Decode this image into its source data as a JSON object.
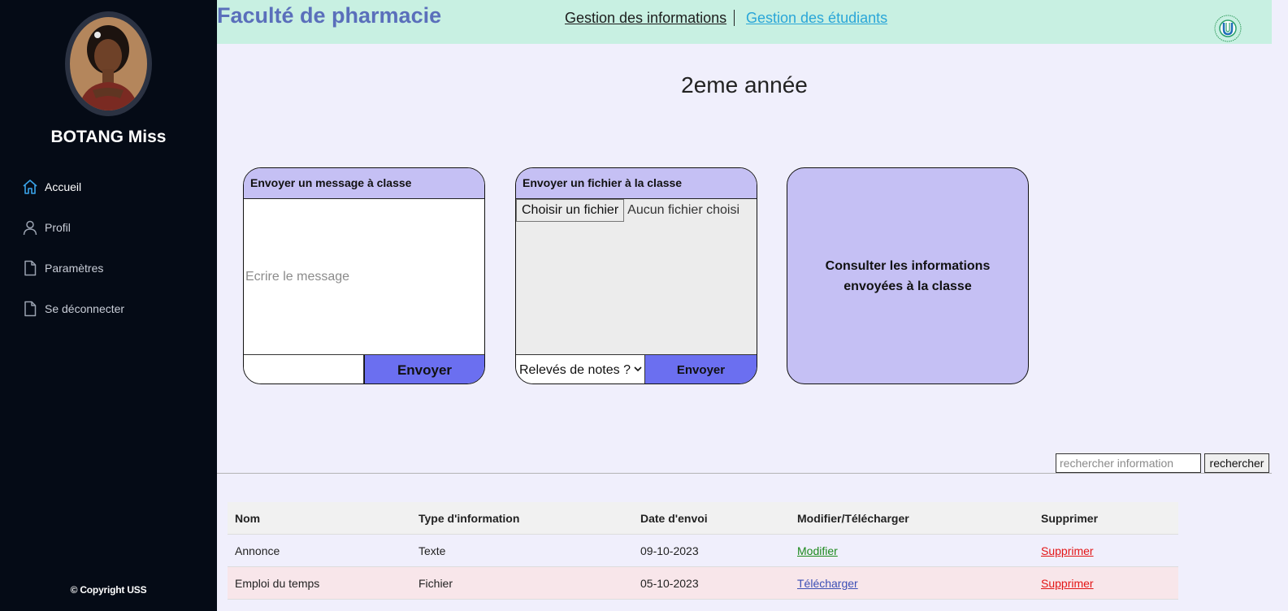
{
  "sidebar": {
    "username": "BOTANG Miss",
    "items": [
      {
        "label": "Accueil",
        "icon": "home-icon",
        "active": true
      },
      {
        "label": "Profil",
        "icon": "user-icon",
        "active": false
      },
      {
        "label": "Paramètres",
        "icon": "file-icon",
        "active": false
      },
      {
        "label": "Se déconnecter",
        "icon": "file-icon",
        "active": false
      }
    ],
    "copyright": "© Copyright USS"
  },
  "header": {
    "title": "Faculté de pharmacie",
    "link_info": "Gestion des informations",
    "link_etudiants": "Gestion des étudiants"
  },
  "page_title": "2eme année",
  "card_message": {
    "title": "Envoyer un message à classe",
    "placeholder": "Ecrire le message",
    "button": "Envoyer"
  },
  "card_file": {
    "title": "Envoyer un fichier à la classe",
    "choose_button": "Choisir un fichier",
    "no_file": "Aucun fichier choisi",
    "select_value": "Relevés de notes ?",
    "button": "Envoyer"
  },
  "card_consult": {
    "label": "Consulter les informations envoyées à la classe"
  },
  "search": {
    "placeholder": "rechercher information",
    "button": "rechercher"
  },
  "table": {
    "columns": [
      "Nom",
      "Type d'information",
      "Date d'envoi",
      "Modifier/Télécharger",
      "Supprimer"
    ],
    "rows": [
      {
        "nom": "Annonce",
        "type": "Texte",
        "date": "09-10-2023",
        "action": "Modifier",
        "delete": "Supprimer"
      },
      {
        "nom": "Emploi du temps",
        "type": "Fichier",
        "date": "05-10-2023",
        "action": "Télécharger",
        "delete": "Supprimer"
      }
    ]
  },
  "colors": {
    "sidebar_bg": "#050b16",
    "header_bg": "#c8f0e2",
    "title_color": "#5a6fbb",
    "card_head": "#c5c0f4",
    "send_button": "#6b6ff0",
    "delete_link": "#e31515"
  }
}
